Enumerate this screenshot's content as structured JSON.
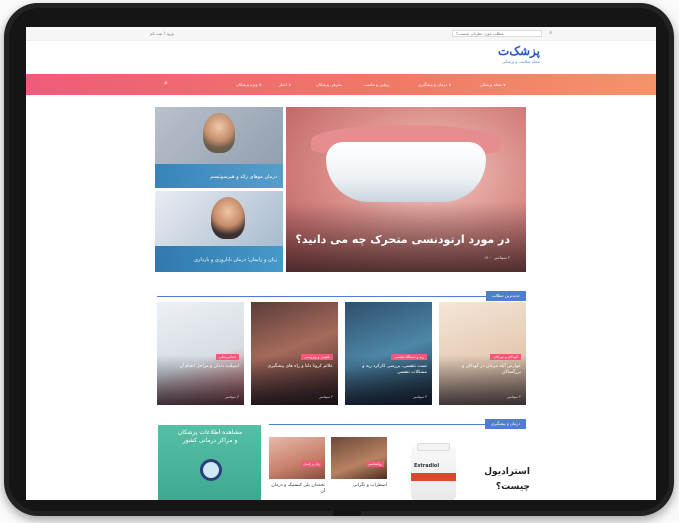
{
  "topbar": {
    "login": "ورود / ثبت نام",
    "search_placeholder": "مطلب مورد نظرتان چیست؟"
  },
  "logo": {
    "mark": "پزشک‌ت",
    "tagline": "مجله سلامت و پزشکی"
  },
  "nav": {
    "items": [
      "مجله پزشکی ∨",
      "درمان و پیشگیری ∨",
      "زیبایی و تناسب",
      "معرفی پزشکان",
      "اخبار ∨",
      "ویژه پزشکان ∨"
    ]
  },
  "hero": {
    "main_title": "در مورد ارتودنسی متحرک چه می دانید؟",
    "main_meta": "۲ سپتامبر ۱۴۰۰",
    "top_caption": "درمان موهای زائد و هیرسوتیسم",
    "bottom_caption": "زنان و زایمان؛ درمان ناباروری و بارداری"
  },
  "latest": {
    "header": "جدیدترین مطالب",
    "cards": [
      {
        "category": "کودکان و نوزادان",
        "title": "عوارض آبله مرغان در کودکان و بزرگسالان",
        "meta": "۴ سپتامبر"
      },
      {
        "category": "ریه و دستگاه تنفسی",
        "title": "تست تنفسی، بررسی کارکرد ریه و مشکلات تنفسی",
        "meta": "۴ سپتامبر"
      },
      {
        "category": "عفونی و ویروسی",
        "title": "علائم کرونا دلتا و راه های پیشگیری",
        "meta": "۴ سپتامبر"
      },
      {
        "category": "دندانپزشکی",
        "title": "ایمپلنت دندان و مراحل انجام آن",
        "meta": "۳ سپتامبر"
      }
    ]
  },
  "treatment": {
    "header": "درمان و پیشگیری",
    "promo_line1": "مشاهده اطلاعات پزشکان",
    "promo_line2": "و مراکز درمانی کشور",
    "small_cards": [
      {
        "category": "روانشناسی",
        "title": "اضطراب و نگرانی"
      },
      {
        "category": "زنان و زایمان",
        "title": "تخمدان پلی کیستیک و درمان آن"
      }
    ],
    "product_brand": "Estradiol",
    "feature_title": "استرادیول چیست؟"
  }
}
